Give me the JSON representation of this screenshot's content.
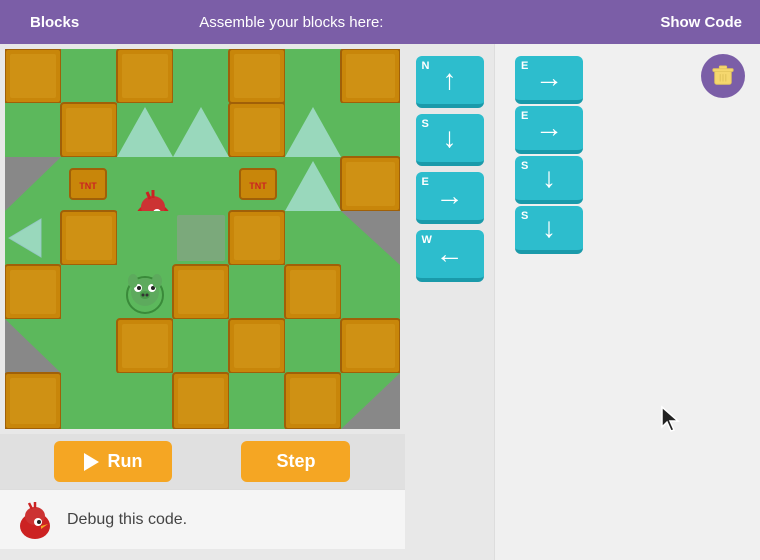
{
  "header": {
    "blocks_label": "Blocks",
    "assemble_label": "Assemble your blocks here:",
    "show_code_label": "Show Code"
  },
  "controls": {
    "run_label": "Run",
    "step_label": "Step"
  },
  "debug": {
    "message": "Debug this code."
  },
  "blocks": [
    {
      "id": "N",
      "label": "N",
      "direction": "up"
    },
    {
      "id": "S",
      "label": "S",
      "direction": "down"
    },
    {
      "id": "E",
      "label": "E",
      "direction": "right"
    },
    {
      "id": "W",
      "label": "W",
      "direction": "left"
    }
  ],
  "assembled_blocks": [
    {
      "id": "E1",
      "label": "E",
      "direction": "right"
    },
    {
      "id": "E2",
      "label": "E",
      "direction": "right"
    },
    {
      "id": "S1",
      "label": "S",
      "direction": "down"
    },
    {
      "id": "S2",
      "label": "S",
      "direction": "down"
    }
  ],
  "trash": {
    "label": "🗑"
  },
  "colors": {
    "header_bg": "#7b5ea7",
    "block_bg": "#2dbdcd",
    "button_bg": "#f5a623"
  }
}
